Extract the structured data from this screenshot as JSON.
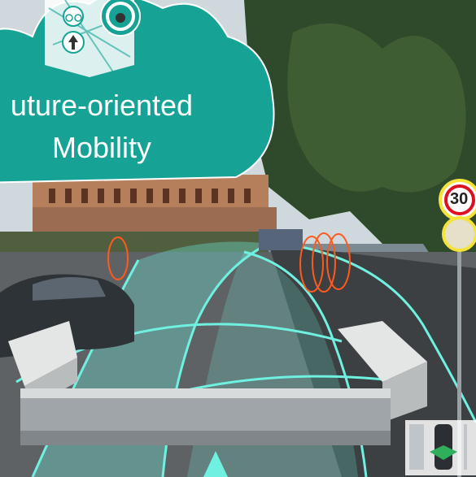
{
  "overlay": {
    "title_line1": "uture-oriented",
    "title_line2": "Mobility"
  },
  "road_sign": {
    "speed_limit": "30"
  },
  "icons": [
    "bicycle-icon",
    "straight-arrow-icon",
    "steering-wheel-icon",
    "car-top-view-icon"
  ],
  "colors": {
    "cloud_teal": "#16a395",
    "lane_cyan": "#6ff0e0",
    "pedestrian_orange": "#ff5a1e",
    "sign_yellow": "#f5e23a"
  }
}
